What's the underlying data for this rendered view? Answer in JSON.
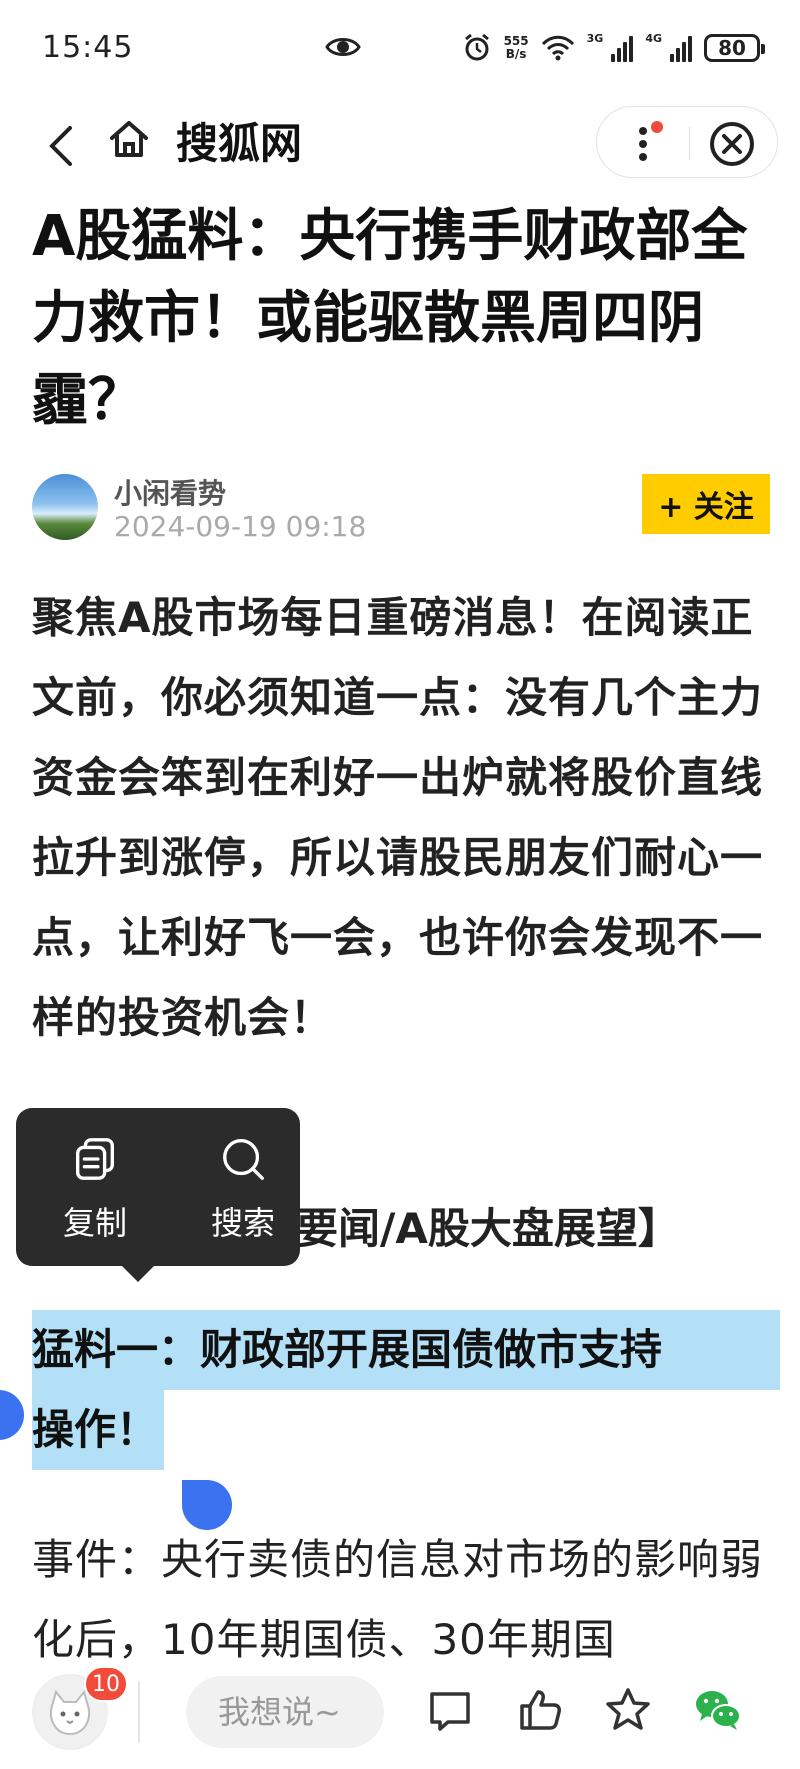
{
  "status_bar": {
    "time": "15:45",
    "net_speed_value": "555",
    "net_speed_unit": "B/s",
    "sig1_label": "3G",
    "sig2_label": "4G",
    "battery": "80"
  },
  "nav": {
    "site_name": "搜狐网"
  },
  "article": {
    "title": "A股猛料：央行携手财政部全力救市！或能驱散黑周四阴霾？",
    "author": "小闲看势",
    "publish_time": "2024-09-19 09:18",
    "follow_label": "+ 关注",
    "intro": "聚焦A股市场每日重磅消息！在阅读正文前，你必须知道一点：没有几个主力资金会笨到在利好一出炉就将股价直线拉升到涨停，所以请股民朋友们耐心一点，让利好飞一会，也许你会发现不一样的投资机会！",
    "topic_partial": "要闻/A股大盘展望】",
    "highlight_line1": "猛料一：财政部开展国债做市支持",
    "highlight_line2": "操作！",
    "event_text": "事件：央行卖债的信息对市场的影响弱化后，10年期国债、30年期国"
  },
  "context_menu": {
    "copy_label": "复制",
    "search_label": "搜索"
  },
  "bottom_bar": {
    "badge_count": "10",
    "comment_placeholder": "我想说~"
  },
  "colors": {
    "follow_bg": "#ffcc00",
    "highlight_bg": "#b3e0f7",
    "selection_handle": "#3a72f0",
    "badge_red": "#f24b3a",
    "wechat_green": "#2bb24c"
  }
}
